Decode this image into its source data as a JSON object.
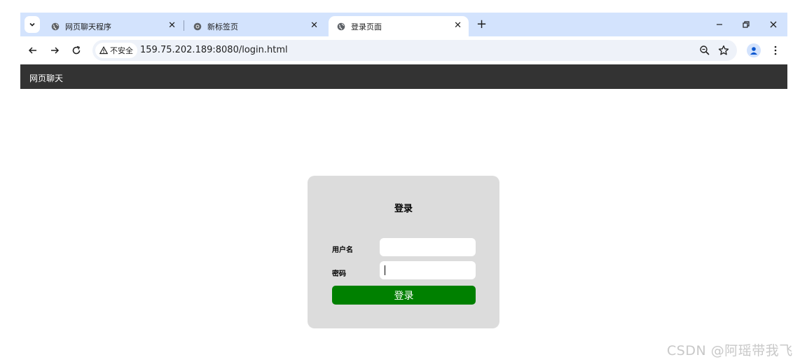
{
  "browser": {
    "tabs": [
      {
        "title": "网页聊天程序",
        "active": false
      },
      {
        "title": "新标签页",
        "active": false
      },
      {
        "title": "登录页面",
        "active": true
      }
    ],
    "new_tab_label": "+",
    "close_glyph": "✕",
    "window_controls": {
      "minimize": "–",
      "restore": "⧉",
      "close": "✕"
    },
    "security_label": "不安全",
    "url": "159.75.202.189:8080/login.html",
    "colors": {
      "tabstrip": "#d3e3fd",
      "omnibox": "#eef2f9"
    }
  },
  "page": {
    "brand": "网页聊天",
    "login": {
      "title": "登录",
      "username_label": "用户名",
      "username_value": "",
      "password_label": "密码",
      "password_value": "",
      "submit_label": "登录"
    },
    "colors": {
      "topbar": "#333333",
      "card": "#dcdcdc",
      "button": "#008000"
    }
  },
  "watermark": "CSDN @阿瑶带我飞"
}
